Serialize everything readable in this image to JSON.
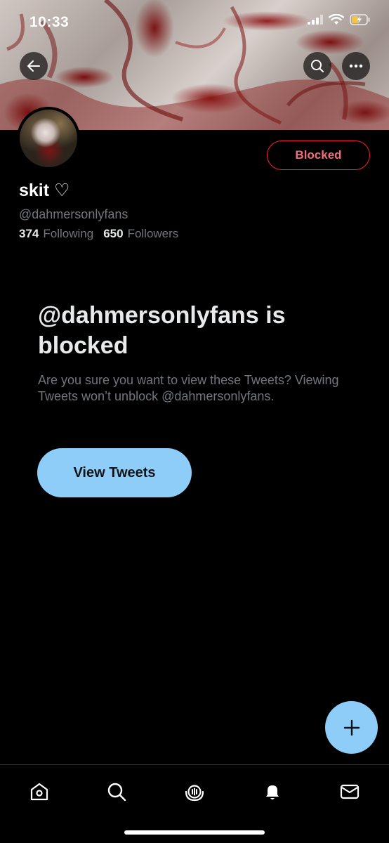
{
  "status_bar": {
    "time": "10:33"
  },
  "header": {
    "back_icon": "arrow-left-icon",
    "search_icon": "search-icon",
    "more_icon": "more-horizontal-icon"
  },
  "profile": {
    "display_name": "skit ♡",
    "handle": "@dahmersonlyfans",
    "following_count": "374",
    "following_label": "Following",
    "followers_count": "650",
    "followers_label": "Followers",
    "blocked_button": "Blocked"
  },
  "blocked_notice": {
    "title": "@dahmersonlyfans is blocked",
    "description": "Are you sure you want to view these Tweets? Viewing Tweets won’t unblock @dahmersonlyfans.",
    "view_button": "View Tweets"
  },
  "colors": {
    "accent": "#8ecdf7",
    "blocked_red": "#f4212e",
    "muted_text": "#71767b"
  },
  "tab_bar": {
    "items": [
      "home-icon",
      "search-icon",
      "spaces-icon",
      "notifications-icon",
      "messages-icon"
    ]
  }
}
